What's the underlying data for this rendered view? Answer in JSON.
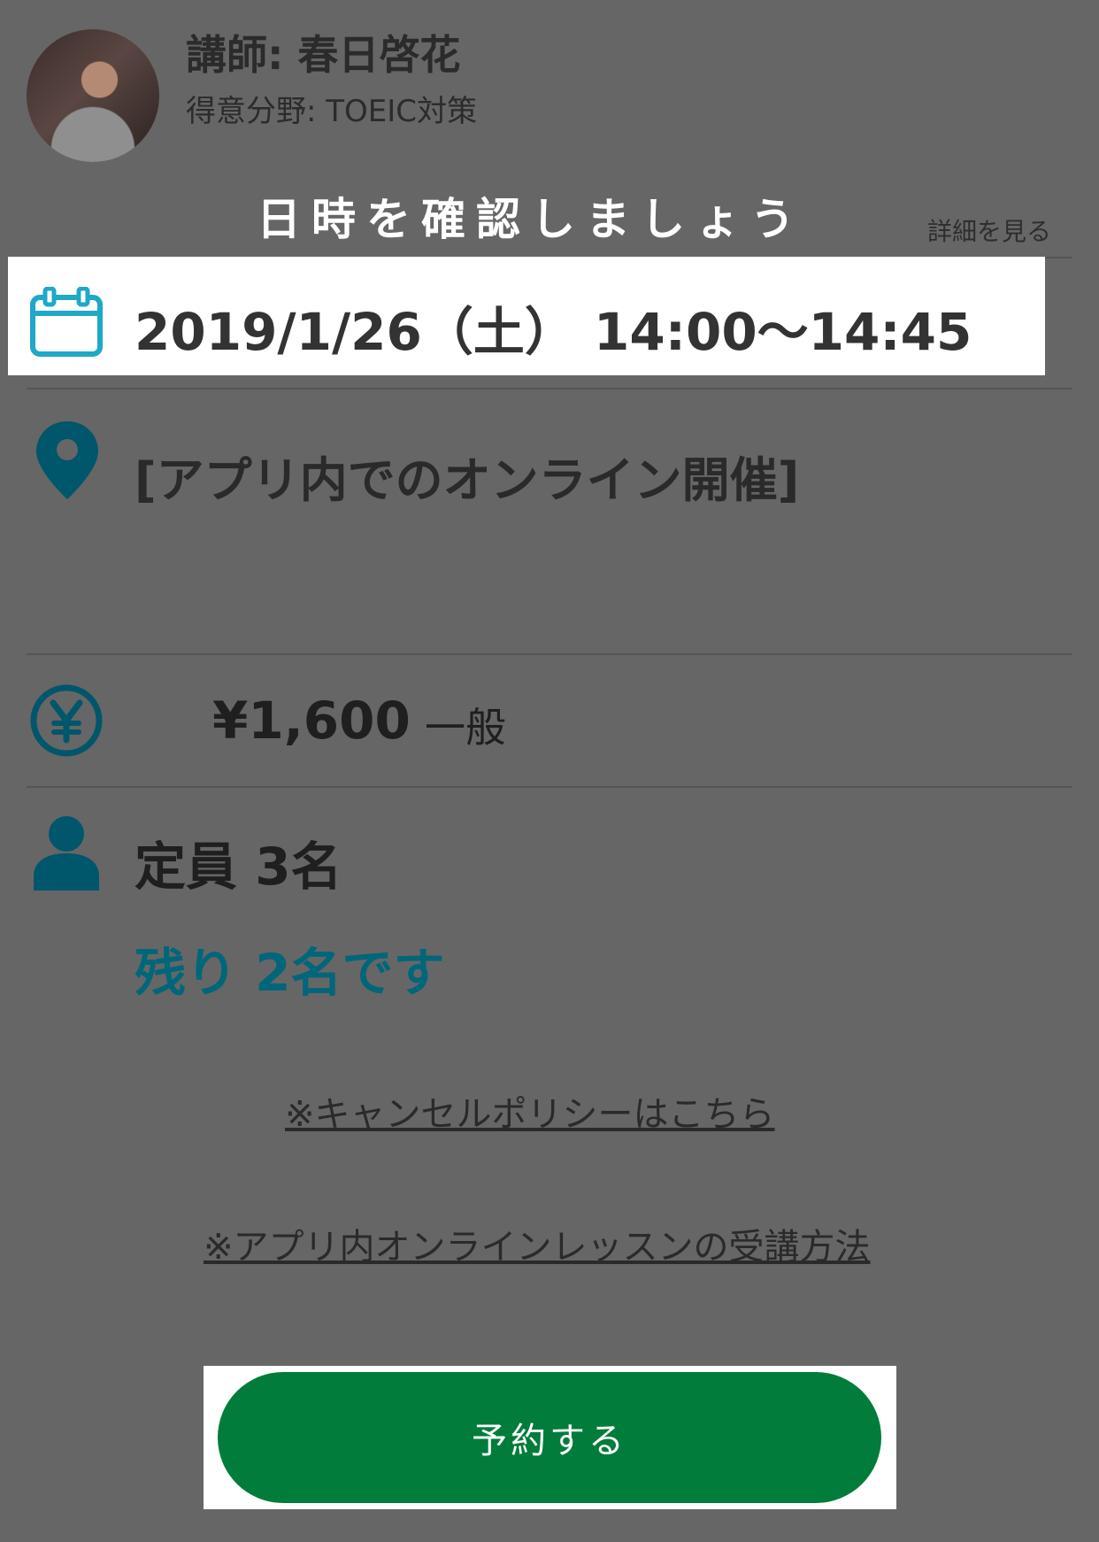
{
  "teacher": {
    "name": "講師: 春日啓花",
    "specialty": "得意分野: TOEIC対策"
  },
  "annotation_caption": "日時を確認しましょう",
  "details_link": "詳細を見る",
  "schedule": {
    "datetime": "2019/1/26（土） 14:00〜14:45",
    "icon": "calendar-icon"
  },
  "location": {
    "text": "[アプリ内でのオンライン開催]",
    "icon": "location-pin-icon"
  },
  "price": {
    "amount": "¥1,600",
    "type": "一般",
    "icon": "yen-icon"
  },
  "capacity": {
    "total": "定員 3名",
    "remaining": "残り 2名です",
    "icon": "person-icon"
  },
  "links": {
    "cancel_policy": "※キャンセルポリシーはこちら",
    "howto": "※アプリ内オンラインレッスンの受講方法"
  },
  "reserve_button": "予約する",
  "colors": {
    "overlay": "#666666",
    "accent_teal": "#00667a",
    "button_green": "#017c3a",
    "calendar_blue": "#1fa8c7"
  }
}
